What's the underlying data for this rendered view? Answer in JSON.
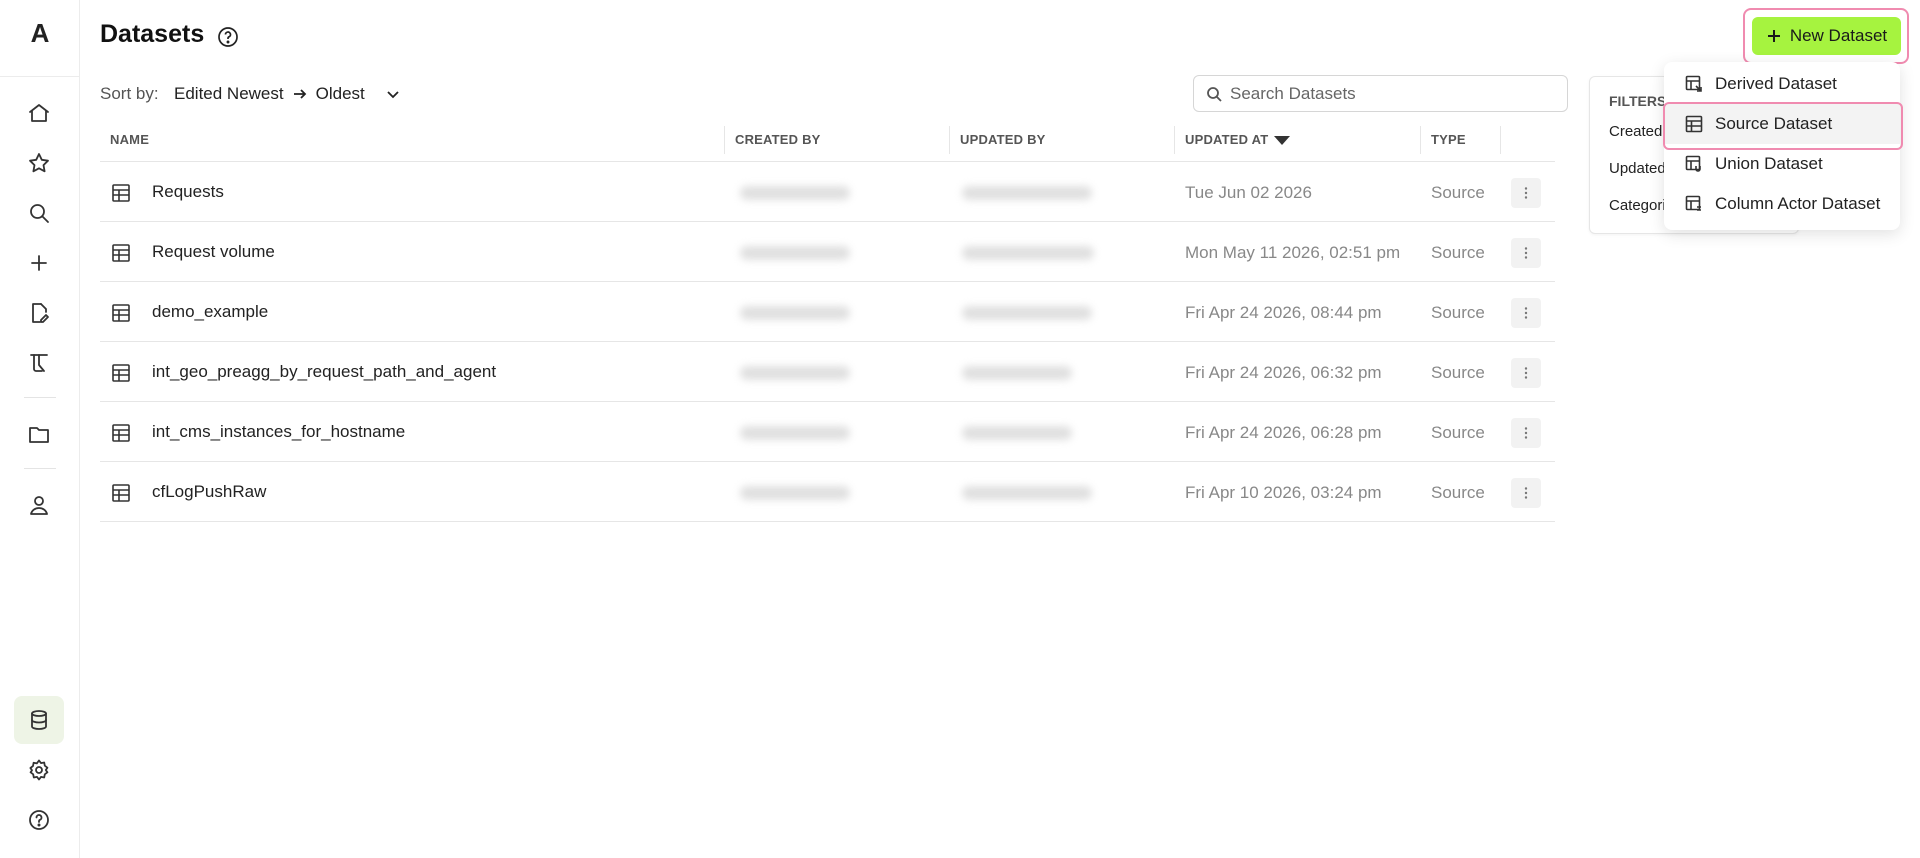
{
  "app": {
    "logo_letter": "A"
  },
  "sidebar": {
    "items": [
      {
        "name": "home-icon"
      },
      {
        "name": "star-icon"
      },
      {
        "name": "search-icon"
      },
      {
        "name": "plus-icon"
      },
      {
        "name": "edit-file-icon"
      },
      {
        "name": "lab-icon"
      },
      {
        "name": "folder-icon"
      },
      {
        "name": "user-icon"
      },
      {
        "name": "database-icon",
        "active": true
      },
      {
        "name": "gear-icon"
      },
      {
        "name": "help-icon"
      }
    ]
  },
  "header": {
    "title": "Datasets"
  },
  "sort": {
    "label": "Sort by:",
    "value_from": "Edited Newest",
    "value_to": "Oldest"
  },
  "search": {
    "placeholder": "Search Datasets"
  },
  "table": {
    "columns": [
      "NAME",
      "CREATED BY",
      "UPDATED BY",
      "UPDATED AT",
      "TYPE"
    ],
    "rows": [
      {
        "name": "Requests",
        "updated_at": "Tue Jun 02 2026",
        "type": "Source"
      },
      {
        "name": "Request volume",
        "updated_at": "Mon May 11 2026, 02:51 pm",
        "type": "Source"
      },
      {
        "name": "demo_example",
        "updated_at": "Fri Apr 24 2026, 08:44 pm",
        "type": "Source"
      },
      {
        "name": "int_geo_preagg_by_request_path_and_agent",
        "updated_at": "Fri Apr 24 2026, 06:32 pm",
        "type": "Source"
      },
      {
        "name": "int_cms_instances_for_hostname",
        "updated_at": "Fri Apr 24 2026, 06:28 pm",
        "type": "Source"
      },
      {
        "name": "cfLogPushRaw",
        "updated_at": "Fri Apr 10 2026, 03:24 pm",
        "type": "Source"
      }
    ]
  },
  "filters": {
    "title": "FILTERS",
    "items": [
      "Created",
      "Updated",
      "Categori"
    ]
  },
  "new_dataset": {
    "label": "New Dataset",
    "accent": "#a6f33f",
    "menu": [
      "Derived Dataset",
      "Source Dataset",
      "Union Dataset",
      "Column Actor Dataset"
    ],
    "selected": "Source Dataset"
  }
}
